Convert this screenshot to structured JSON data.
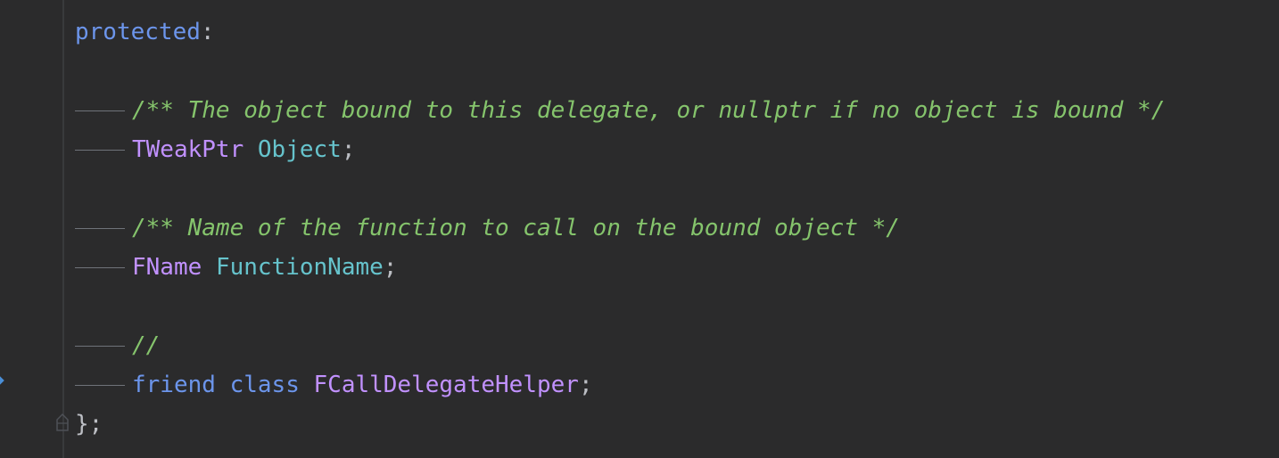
{
  "colors": {
    "background": "#2b2b2c",
    "keyword": "#6c95eb",
    "comment": "#85c46c",
    "type": "#c191ff",
    "field": "#66c3cc",
    "punctuation": "#bcbec4",
    "indent_guide": "#6f737a"
  },
  "code": {
    "line1": {
      "keyword": "protected",
      "punct": ":"
    },
    "line3": {
      "comment": "/** The object bound to this delegate, or nullptr if no object is bound */"
    },
    "line4": {
      "type": "TWeakPtr",
      "field": "Object",
      "punct": ";"
    },
    "line6": {
      "comment": "/** Name of the function to call on the bound object */"
    },
    "line7": {
      "type": "FName",
      "field": "FunctionName",
      "punct": ";"
    },
    "line9": {
      "comment": "//"
    },
    "line10": {
      "kw1": "friend",
      "kw2": "class",
      "type": "FCallDelegateHelper",
      "punct": ";"
    },
    "line11": {
      "punct": "};"
    }
  },
  "gutter": {
    "marker_icon": "implementation-arrow-icon",
    "fold_icon": "fold-end-icon"
  }
}
